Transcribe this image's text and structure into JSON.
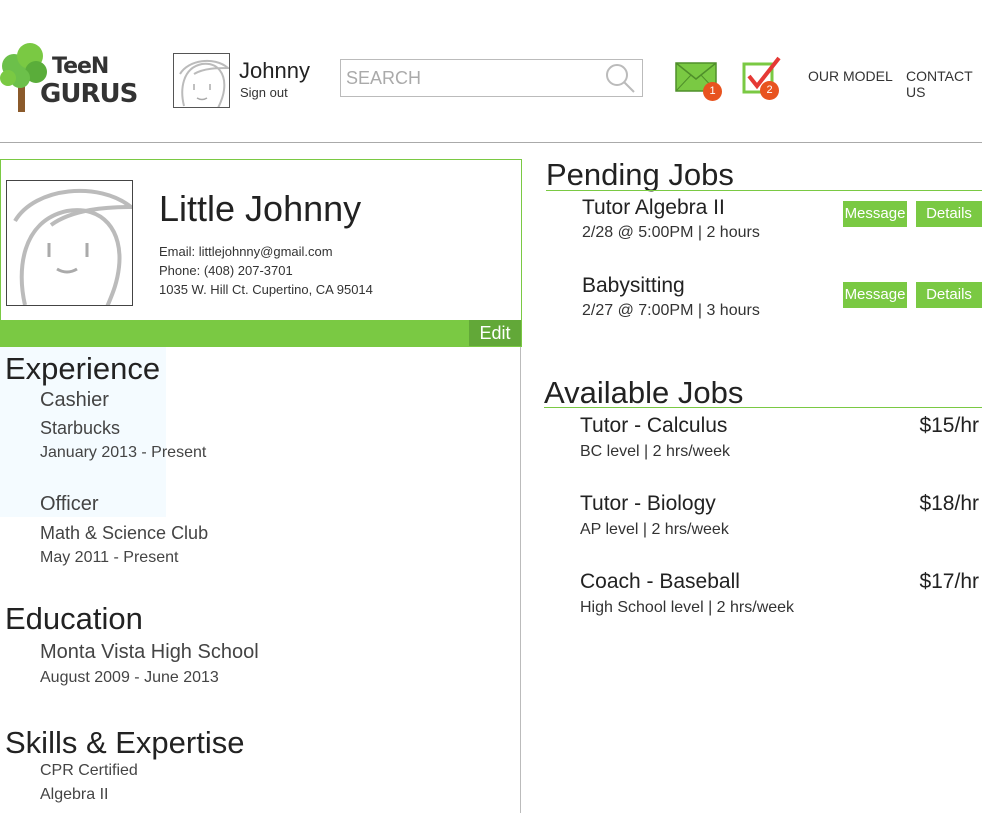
{
  "brand": {
    "line1": "TeeN",
    "line2": "GURUS",
    "tree_color": "#6cc04a",
    "trunk_color": "#8b5a2b"
  },
  "header": {
    "user_name": "Johnny",
    "sign_out": "Sign out",
    "search_placeholder": "SEARCH",
    "messages_count": "1",
    "tasks_count": "2",
    "nav": {
      "our_model": "OUR MODEL",
      "contact_us": "CONTACT US"
    }
  },
  "profile": {
    "name": "Little Johnny",
    "email": "Email: littlejohnny@gmail.com",
    "phone": "Phone: (408) 207-3701",
    "address": "1035 W. Hill Ct. Cupertino, CA 95014",
    "edit_label": "Edit"
  },
  "experience": {
    "title": "Experience",
    "items": [
      {
        "role": "Cashier",
        "org": "Starbucks",
        "dates": "January 2013 - Present"
      },
      {
        "role": "Officer",
        "org": "Math & Science Club",
        "dates": "May 2011 - Present"
      }
    ]
  },
  "education": {
    "title": "Education",
    "school": "Monta Vista High School",
    "dates": "August 2009 - June 2013"
  },
  "skills": {
    "title": "Skills & Expertise",
    "items": [
      "CPR Certified",
      "Algebra II"
    ]
  },
  "pending": {
    "title": "Pending Jobs",
    "message_label": "Message",
    "details_label": "Details",
    "jobs": [
      {
        "title": "Tutor Algebra II",
        "detail": "2/28 @ 5:00PM | 2 hours"
      },
      {
        "title": "Babysitting",
        "detail": "2/27 @ 7:00PM | 3 hours"
      }
    ]
  },
  "available": {
    "title": "Available Jobs",
    "jobs": [
      {
        "title": "Tutor - Calculus",
        "detail": "BC level | 2 hrs/week",
        "rate": "$15/hr"
      },
      {
        "title": "Tutor - Biology",
        "detail": "AP level | 2 hrs/week",
        "rate": "$18/hr"
      },
      {
        "title": "Coach - Baseball",
        "detail": "High School level | 2 hrs/week",
        "rate": "$17/hr"
      }
    ]
  },
  "colors": {
    "accent_green": "#7ac943",
    "dark_green": "#62a838",
    "badge_orange": "#e8531f",
    "check_red": "#e53935"
  }
}
